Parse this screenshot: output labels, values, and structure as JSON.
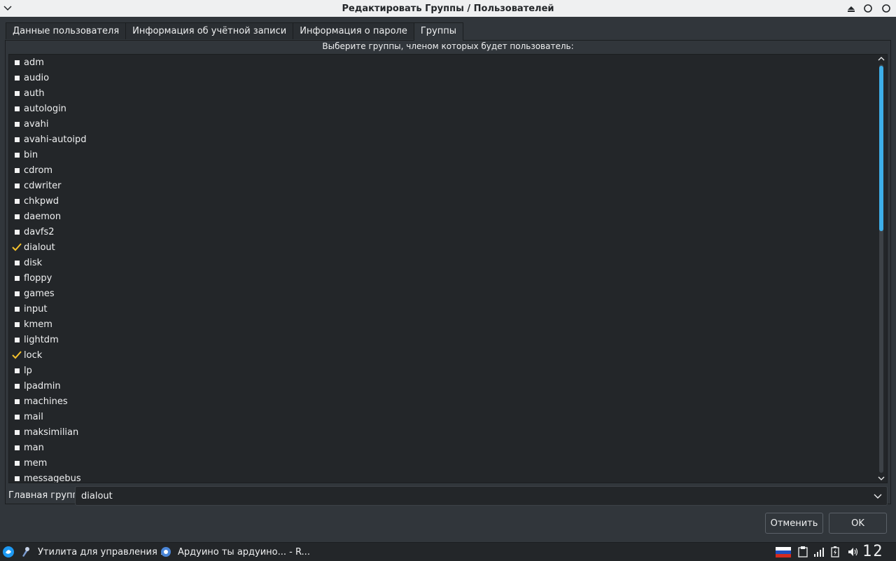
{
  "window": {
    "title": "Редактировать Группы / Пользователей"
  },
  "tabs": [
    {
      "label": "Данные пользователя",
      "active": false
    },
    {
      "label": "Информация об учётной записи",
      "active": false
    },
    {
      "label": "Информация о пароле",
      "active": false
    },
    {
      "label": "Группы",
      "active": true
    }
  ],
  "groups_panel": {
    "prompt": "Выберите группы, членом которых будет пользователь:",
    "items": [
      {
        "name": "adm",
        "checked": false
      },
      {
        "name": "audio",
        "checked": false
      },
      {
        "name": "auth",
        "checked": false
      },
      {
        "name": "autologin",
        "checked": false
      },
      {
        "name": "avahi",
        "checked": false
      },
      {
        "name": "avahi-autoipd",
        "checked": false
      },
      {
        "name": "bin",
        "checked": false
      },
      {
        "name": "cdrom",
        "checked": false
      },
      {
        "name": "cdwriter",
        "checked": false
      },
      {
        "name": "chkpwd",
        "checked": false
      },
      {
        "name": "daemon",
        "checked": false
      },
      {
        "name": "davfs2",
        "checked": false
      },
      {
        "name": "dialout",
        "checked": true
      },
      {
        "name": "disk",
        "checked": false
      },
      {
        "name": "floppy",
        "checked": false
      },
      {
        "name": "games",
        "checked": false
      },
      {
        "name": "input",
        "checked": false
      },
      {
        "name": "kmem",
        "checked": false
      },
      {
        "name": "lightdm",
        "checked": false
      },
      {
        "name": "lock",
        "checked": true
      },
      {
        "name": "lp",
        "checked": false
      },
      {
        "name": "lpadmin",
        "checked": false
      },
      {
        "name": "machines",
        "checked": false
      },
      {
        "name": "mail",
        "checked": false
      },
      {
        "name": "maksimilian",
        "checked": false
      },
      {
        "name": "man",
        "checked": false
      },
      {
        "name": "mem",
        "checked": false
      },
      {
        "name": "messagebus",
        "checked": false
      }
    ]
  },
  "main_group": {
    "label": "Главная группа",
    "value": "dialout"
  },
  "buttons": {
    "cancel": "Отменить",
    "ok": "OK"
  },
  "taskbar": {
    "tasks": [
      {
        "label": "Утилита для управления ...",
        "icon": "settings-app-icon"
      },
      {
        "label": "Ардуино ты ардуино... - R...",
        "icon": "browser-icon"
      }
    ],
    "clock": "12"
  },
  "colors": {
    "accent": "#3daee9",
    "check": "#f6c22d",
    "background": "#31363b",
    "list_background": "#232629"
  }
}
